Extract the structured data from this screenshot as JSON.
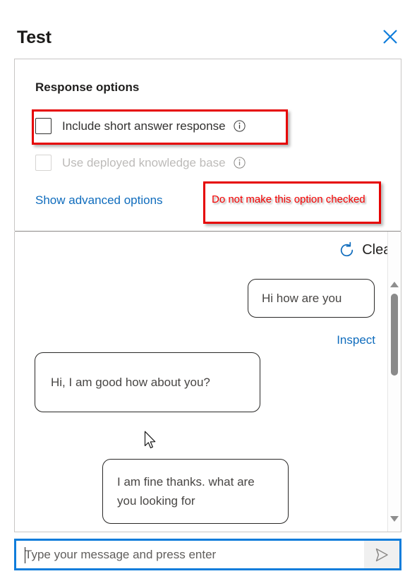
{
  "dialog": {
    "title": "Test",
    "close_icon": "close-icon"
  },
  "options": {
    "section_title": "Response options",
    "items": [
      {
        "label": "Include short answer response",
        "checked": false,
        "disabled": false,
        "info_icon": "info-icon"
      },
      {
        "label": "Use deployed knowledge base",
        "checked": false,
        "disabled": true,
        "info_icon": "info-icon"
      }
    ],
    "advanced_link": "Show advanced options"
  },
  "annotations": [
    {
      "name": "checkbox-highlight",
      "text": "",
      "color": "#e60000"
    },
    {
      "name": "instruction-note",
      "text": "Do not make this option checked",
      "color": "#f40000"
    }
  ],
  "chat": {
    "clear_label": "Clear",
    "clear_icon": "refresh-icon",
    "inspect_label": "Inspect",
    "messages": [
      {
        "author": "user",
        "text": "Hi how are you"
      },
      {
        "author": "bot",
        "text": "Hi, I am good how about you?"
      },
      {
        "author": "user",
        "text": "I am fine thanks. what are you looking for"
      }
    ],
    "scrollbar": {
      "up_icon": "chevron-up-icon",
      "down_icon": "chevron-down-icon"
    }
  },
  "composer": {
    "placeholder": "Type your message and press enter",
    "value": "",
    "send_icon": "send-icon"
  },
  "colors": {
    "accent": "#0f6cbd",
    "focus_border": "#0f7ddb",
    "annotation": "#e60000",
    "bubble_border": "#292827"
  }
}
